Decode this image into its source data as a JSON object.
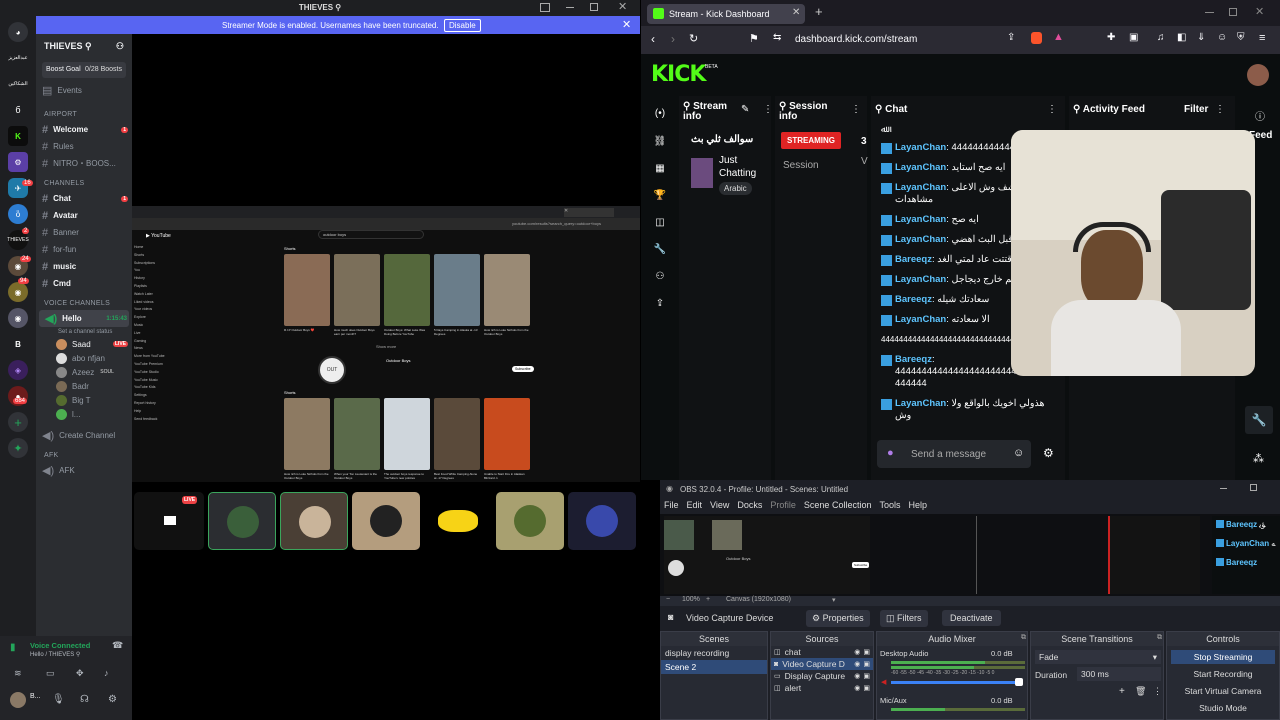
{
  "discord": {
    "title": "THIEVES ⚲",
    "banner_text": "Streamer Mode is enabled. Usernames have been truncated.",
    "banner_button": "Disable",
    "server_name": "THIEVES ⚲",
    "boost_goal": "Boost Goal",
    "boost_count": "0/28 Boosts",
    "events": "Events",
    "category_airport": "Airport",
    "airport_channels": [
      "Welcome",
      "Rules",
      "NITRO・BOOS..."
    ],
    "category_channels": "CHANNELS",
    "text_channels": [
      "Chat",
      "Avatar",
      "Banner",
      "for-fun",
      "music",
      "Cmd"
    ],
    "category_voice": "VOICE CHANNELS",
    "voice_channel": "Hello",
    "voice_time": "1:15:43",
    "voice_status": "Set a channel status",
    "voice_users": [
      "Saad",
      "abo nfjan",
      "Azeez",
      "Badr",
      "Big T",
      "l..."
    ],
    "live_label": "LIVE",
    "soul_tag": "SOUL",
    "create_channel": "Create Channel",
    "category_afk": "AFK",
    "afk_channel": "AFK",
    "voice_connected": "Voice Connected",
    "voice_connected_sub": "Hello / THIEVES ⚲",
    "user_short": "B...",
    "server_badges": [
      "16",
      "2",
      "24",
      "684",
      "94"
    ]
  },
  "stream_preview": {
    "url": "youtube.com/results?search_query=outdoor+boys",
    "search_query": "outdoor boys",
    "shorts_label": "Shorts",
    "channel_name": "Outdoor Boys",
    "subscribe": "Subscribe",
    "show_more": "Show more",
    "sidebar": [
      "Home",
      "Shorts",
      "Subscriptions",
      "You",
      "History",
      "Playlists",
      "Watch Later",
      "Liked videos",
      "Your videos",
      "Explore",
      "Music",
      "Live",
      "Gaming",
      "News",
      "More from YouTube",
      "YouTube Premium",
      "YouTube Studio",
      "YouTube Music",
      "YouTube Kids",
      "Settings",
      "Report history",
      "Help",
      "Send feedback"
    ],
    "row1_titles": [
      "R.I.P Outdoor Boys ❤️",
      "How much does Outdoor Boys earn per month?",
      "Outdoor Boys: What Luke Was Doing Before YouTube",
      "5 Days Camping in Alaska at -13 Degrees",
      "How rich is Luke Nichols from the Outdoor Boys"
    ],
    "row2_titles": [
      "How rich is Luke Nichols from the Outdoor Boys",
      "When your Ton Lieutenant is the Outdoor Boys",
      "The outdoor boys response to YouTube's new policies",
      "Best Food While Camping Alone at -17 Degrees",
      "Unable to Start Fire in Alaskan Blizzard ⚠"
    ],
    "live_label": "LIVE"
  },
  "browser": {
    "tab_title": "Stream - Kick Dashboard",
    "url": "dashboard.kick.com/stream"
  },
  "kick": {
    "logo": "KICK",
    "logo_beta": "BETA",
    "stream_info_title": "Stream info",
    "stream_title": "سوالف ثلي بث",
    "category": "Just Chatting",
    "language_tag": "Arabic",
    "session_info_title": "Session info",
    "streaming_badge": "STREAMING",
    "session_label": "Session",
    "session_count": "3",
    "session_v": "V",
    "chat_title": "Chat",
    "activity_title": "Activity Feed",
    "filter": "Filter",
    "feed_label": "Feed",
    "send_placeholder": "Send a message",
    "chat_top": "ﷲ",
    "chat_messages": [
      {
        "user": "LayanChan",
        "text": "مم 4444444444444"
      },
      {
        "user": "LayanChan",
        "text": "ايه صح استايد"
      },
      {
        "user": "LayanChan",
        "text": "الاوقات وشف وش الاعلى مشاهدات"
      },
      {
        "user": "LayanChan",
        "text": "ايه صح"
      },
      {
        "user": "LayanChan",
        "text": "لجه حطها قبل البث اهضي"
      },
      {
        "user": "Bareeqz",
        "text": "لوقتتت عاد لمتي الغد"
      },
      {
        "user": "LayanChan",
        "text": "تم خارج ديجاجل"
      },
      {
        "user": "Bareeqz",
        "text": "سعادتك شيله"
      },
      {
        "user": "LayanChan",
        "text": "الا سعادته"
      },
      {
        "user": "",
        "text": "4444444444444444444444444444444444444444"
      },
      {
        "user": "Bareeqz",
        "text": "4444444444444444444444444444444444444"
      },
      {
        "user": "LayanChan",
        "text": "هذولي اخويك بالواقع ولا وش"
      }
    ]
  },
  "obs": {
    "title": "OBS 32.0.4 - Profile: Untitled - Scenes: Untitled",
    "menu": [
      "File",
      "Edit",
      "View",
      "Docks",
      "Profile",
      "Scene Collection",
      "Tools",
      "Help"
    ],
    "zoom": "100%",
    "canvas": "Canvas (1920x1080)",
    "source_name": "Video Capture Device",
    "properties": "Properties",
    "filters": "Filters",
    "deactivate": "Deactivate",
    "scenes_title": "Scenes",
    "scenes": [
      "display recording",
      "Scene 2"
    ],
    "sources_title": "Sources",
    "sources": [
      "chat",
      "Video Capture D",
      "Display Capture",
      "alert"
    ],
    "mixer_title": "Audio Mixer",
    "desktop_audio": "Desktop Audio",
    "desktop_db": "0.0 dB",
    "mic_aux": "Mic/Aux",
    "mic_db": "0.0 dB",
    "meter_ticks": "-60 -55 -50 -45 -40 -35 -30 -25 -20 -15 -10 -5 0",
    "transitions_title": "Scene Transitions",
    "transition": "Fade",
    "duration_label": "Duration",
    "duration": "300 ms",
    "controls_title": "Controls",
    "controls": [
      "Stop Streaming",
      "Start Recording",
      "Start Virtual Camera",
      "Studio Mode"
    ],
    "preview_chat": [
      {
        "user": "Bareeqz",
        "text": "ﺆﻳ"
      },
      {
        "user": "LayanChan",
        "text": "ﻪ"
      },
      {
        "user": "Bareeqz",
        "text": ""
      }
    ]
  },
  "colors": {
    "kick_green": "#53fc18",
    "discord_bg": "#1e1f22",
    "streaming_red": "#e02424",
    "banner_blue": "#5865f2"
  }
}
